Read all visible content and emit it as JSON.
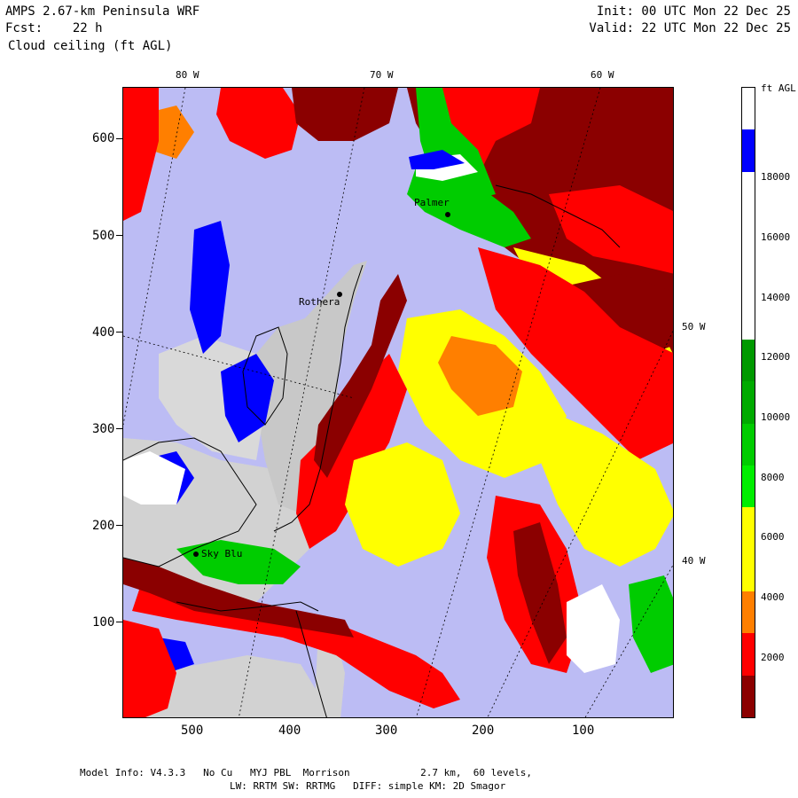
{
  "header": {
    "title": "AMPS 2.67-km Peninsula WRF",
    "forecast": "Fcst:    22 h",
    "field": "Cloud ceiling (ft AGL)",
    "init": "Init: 00 UTC Mon 22 Dec 25",
    "valid": "Valid: 22 UTC Mon 22 Dec 25"
  },
  "map": {
    "lon_labels_top": [
      "80 W",
      "70 W",
      "60 W"
    ],
    "lon_labels_right": [
      "50 W",
      "40 W"
    ],
    "y_ticks": [
      "600",
      "500",
      "400",
      "300",
      "200",
      "100"
    ],
    "x_ticks": [
      "500",
      "400",
      "300",
      "200",
      "100"
    ],
    "stations": [
      "Palmer",
      "Rothera",
      "Sky Blu"
    ],
    "colors": {
      "background_clear": "#bcbcf4",
      "land": "#d2d2d2",
      "dark_red": "#8b0000",
      "red": "#ff0000",
      "orange": "#ff7f00",
      "yellow": "#ffff00",
      "green": "#00cc00",
      "dark_green": "#009900",
      "white": "#ffffff",
      "blue": "#0000ff"
    }
  },
  "colorbar": {
    "unit_label": "ft AGL",
    "labels": [
      "18000",
      "16000",
      "14000",
      "12000",
      "10000",
      "8000",
      "6000",
      "4000",
      "2000"
    ],
    "bands": [
      {
        "color": "#ffffff"
      },
      {
        "color": "#0000ff"
      },
      {
        "color": "#ffffff"
      },
      {
        "color": "#ffffff"
      },
      {
        "color": "#ffffff"
      },
      {
        "color": "#ffffff"
      },
      {
        "color": "#009900"
      },
      {
        "color": "#00aa00"
      },
      {
        "color": "#00cc00"
      },
      {
        "color": "#00ee00"
      },
      {
        "color": "#ffff00"
      },
      {
        "color": "#ffff00"
      },
      {
        "color": "#ff7f00"
      },
      {
        "color": "#ff0000"
      },
      {
        "color": "#8b0000"
      }
    ]
  },
  "footer": {
    "line1": "Model Info: V4.3.3   No Cu   MYJ PBL  Morrison            2.7 km,  60 levels,",
    "line2": "LW: RRTM SW: RRTMG   DIFF: simple KM: 2D Smagor"
  }
}
